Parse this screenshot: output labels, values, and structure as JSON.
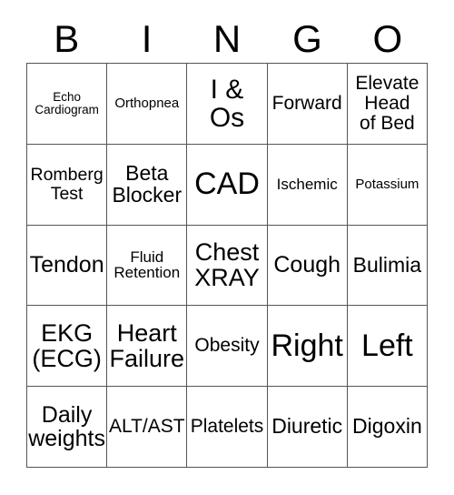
{
  "card": {
    "header_letters": [
      "B",
      "I",
      "N",
      "G",
      "O"
    ],
    "rows": [
      [
        {
          "text": "Echo\nCardiogram",
          "size": "fs-13"
        },
        {
          "text": "Orthopnea",
          "size": "fs-15"
        },
        {
          "text": "I &\nOs",
          "size": "fs-30"
        },
        {
          "text": "Forward",
          "size": "fs-21"
        },
        {
          "text": "Elevate\nHead\nof Bed",
          "size": "fs-21"
        }
      ],
      [
        {
          "text": "Romberg\nTest",
          "size": "fs-19"
        },
        {
          "text": "Beta\nBlocker",
          "size": "fs-23"
        },
        {
          "text": "CAD",
          "size": "fs-34"
        },
        {
          "text": "Ischemic",
          "size": "fs-17"
        },
        {
          "text": "Potassium",
          "size": "fs-15"
        }
      ],
      [
        {
          "text": "Tendon",
          "size": "fs-25"
        },
        {
          "text": "Fluid\nRetention",
          "size": "fs-17"
        },
        {
          "text": "Chest\nXRAY",
          "size": "fs-27"
        },
        {
          "text": "Cough",
          "size": "fs-25"
        },
        {
          "text": "Bulimia",
          "size": "fs-23"
        }
      ],
      [
        {
          "text": "EKG\n(ECG)",
          "size": "fs-27"
        },
        {
          "text": "Heart\nFailure",
          "size": "fs-27"
        },
        {
          "text": "Obesity",
          "size": "fs-21"
        },
        {
          "text": "Right",
          "size": "fs-34"
        },
        {
          "text": "Left",
          "size": "fs-34"
        }
      ],
      [
        {
          "text": "Daily\nweights",
          "size": "fs-25"
        },
        {
          "text": "ALT/AST",
          "size": "fs-21"
        },
        {
          "text": "Platelets",
          "size": "fs-21"
        },
        {
          "text": "Diuretic",
          "size": "fs-23"
        },
        {
          "text": "Digoxin",
          "size": "fs-23"
        }
      ]
    ]
  }
}
